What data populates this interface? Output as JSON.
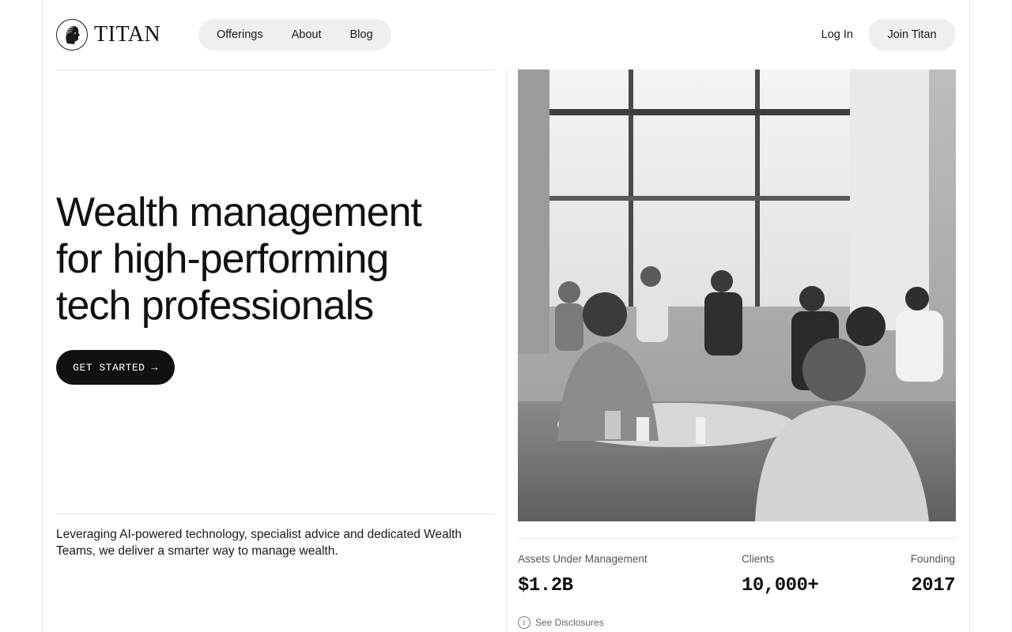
{
  "brand": {
    "name": "TITAN",
    "logo_icon": "classical-head-medallion-icon"
  },
  "nav": {
    "items": [
      {
        "label": "Offerings"
      },
      {
        "label": "About"
      },
      {
        "label": "Blog"
      }
    ],
    "login_label": "Log In",
    "join_label": "Join Titan"
  },
  "hero": {
    "headline_line1": "Wealth management",
    "headline_line2": "for high-performing",
    "headline_line3": "tech professionals",
    "cta_label": "GET STARTED",
    "cta_arrow": "→",
    "blurb": "Leveraging AI-powered technology, specialist advice and dedicated Wealth Teams, we deliver a smarter way to manage wealth."
  },
  "stats": [
    {
      "label": "Assets Under Management",
      "value": "$1.2B"
    },
    {
      "label": "Clients",
      "value": "10,000+"
    },
    {
      "label": "Founding",
      "value": "2017"
    }
  ],
  "disclosures": {
    "label": "See Disclosures",
    "icon": "info-circle-icon"
  },
  "colors": {
    "text": "#111111",
    "pill_bg": "#f0efed",
    "cta_bg": "#111111",
    "rule": "#e6e6e6"
  }
}
